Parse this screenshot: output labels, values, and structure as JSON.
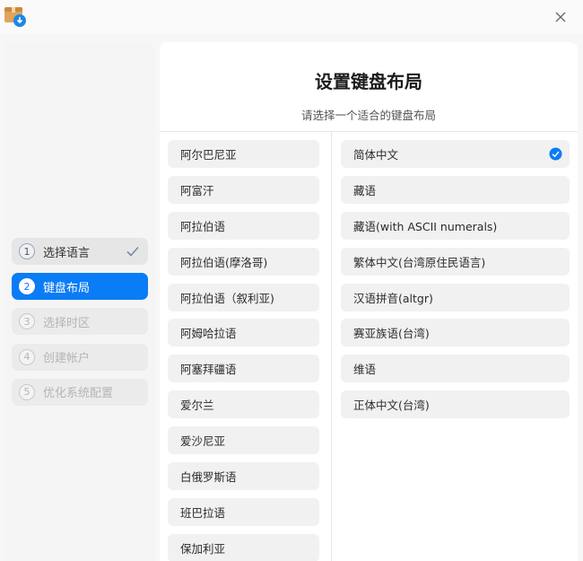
{
  "window": {
    "app_icon": "package-installer-icon",
    "close_icon": "close-icon"
  },
  "sidebar": {
    "steps": [
      {
        "num": "1",
        "label": "选择语言",
        "state": "done"
      },
      {
        "num": "2",
        "label": "键盘布局",
        "state": "active"
      },
      {
        "num": "3",
        "label": "选择时区",
        "state": "pending"
      },
      {
        "num": "4",
        "label": "创建帐户",
        "state": "pending"
      },
      {
        "num": "5",
        "label": "优化系统配置",
        "state": "pending"
      }
    ]
  },
  "main": {
    "title": "设置键盘布局",
    "subtitle": "请选择一个适合的键盘布局",
    "languages": [
      "阿尔巴尼亚",
      "阿富汗",
      "阿拉伯语",
      "阿拉伯语(摩洛哥)",
      "阿拉伯语（叙利亚)",
      "阿姆哈拉语",
      "阿塞拜疆语",
      "爱尔兰",
      "爱沙尼亚",
      "白俄罗斯语",
      "班巴拉语",
      "保加利亚"
    ],
    "variants": [
      "简体中文",
      "藏语",
      "藏语(with ASCII numerals)",
      "繁体中文(台湾原住民语言)",
      "汉语拼音(altgr)",
      "赛亚族语(台湾)",
      "维语",
      "正体中文(台湾)"
    ],
    "selected_variant_index": 0
  },
  "colors": {
    "accent": "#0a7cf5",
    "item_bg": "#f1f1f1",
    "sidebar_bg": "#f5f5f5"
  }
}
